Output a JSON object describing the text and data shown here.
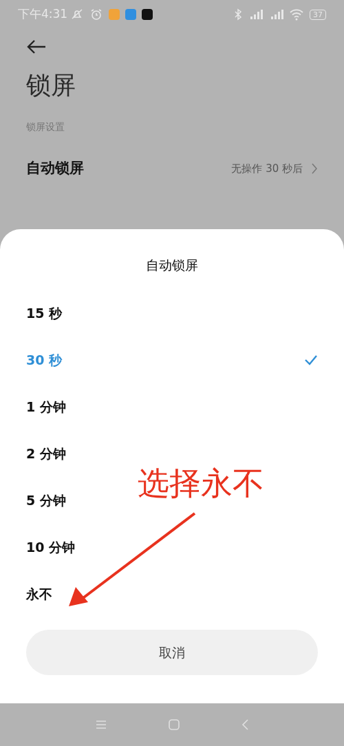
{
  "status_bar": {
    "time": "下午4:31",
    "battery": "37"
  },
  "page": {
    "title": "锁屏",
    "section": "锁屏设置",
    "rows": [
      {
        "label": "自动锁屏",
        "value": "无操作 30 秒后"
      }
    ]
  },
  "sheet": {
    "title": "自动锁屏",
    "options": [
      {
        "label": "15 秒",
        "selected": false
      },
      {
        "label": "30 秒",
        "selected": true
      },
      {
        "label": "1 分钟",
        "selected": false
      },
      {
        "label": "2 分钟",
        "selected": false
      },
      {
        "label": "5 分钟",
        "selected": false
      },
      {
        "label": "10 分钟",
        "selected": false
      },
      {
        "label": "永不",
        "selected": false
      }
    ],
    "cancel": "取消"
  },
  "annotation": {
    "text": "选择永不"
  }
}
